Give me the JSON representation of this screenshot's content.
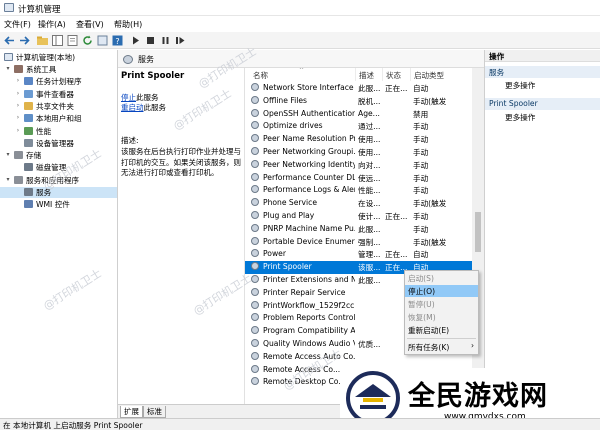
{
  "window": {
    "title": "计算机管理"
  },
  "menu": [
    "文件(F)",
    "操作(A)",
    "查看(V)",
    "帮助(H)"
  ],
  "tree": {
    "root": "计算机管理(本地)",
    "items": [
      {
        "label": "系统工具",
        "level": 1,
        "expander": "▾"
      },
      {
        "label": "任务计划程序",
        "level": 2,
        "expander": "›"
      },
      {
        "label": "事件查看器",
        "level": 2,
        "expander": "›"
      },
      {
        "label": "共享文件夹",
        "level": 2,
        "expander": "›"
      },
      {
        "label": "本地用户和组",
        "level": 2,
        "expander": "›"
      },
      {
        "label": "性能",
        "level": 2,
        "expander": "›"
      },
      {
        "label": "设备管理器",
        "level": 2,
        "expander": ""
      },
      {
        "label": "存储",
        "level": 1,
        "expander": "▾"
      },
      {
        "label": "磁盘管理",
        "level": 2,
        "expander": ""
      },
      {
        "label": "服务和应用程序",
        "level": 1,
        "expander": "▾"
      },
      {
        "label": "服务",
        "level": 2,
        "expander": "",
        "selected": true
      },
      {
        "label": "WMI 控件",
        "level": 2,
        "expander": ""
      }
    ]
  },
  "center": {
    "header": "服务",
    "service_name": "Print Spooler",
    "stop_link": "停止",
    "stop_suffix": "此服务",
    "restart_link": "重启动",
    "restart_suffix": "此服务",
    "desc_label": "描述:",
    "desc_text": "该服务在后台执行打印作业并处理与打印机的交互。如果关闭该服务，则无法进行打印或查看打印机。"
  },
  "columns": {
    "name": "名称",
    "desc": "描述",
    "status": "状态",
    "startup": "启动类型"
  },
  "services": [
    {
      "name": "Network Store Interface ...",
      "desc": "此服...",
      "status": "正在...",
      "startup": "自动"
    },
    {
      "name": "Offline Files",
      "desc": "脱机...",
      "status": "",
      "startup": "手动(触发"
    },
    {
      "name": "OpenSSH Authentication ...",
      "desc": "Age...",
      "status": "",
      "startup": "禁用"
    },
    {
      "name": "Optimize drives",
      "desc": "通过...",
      "status": "",
      "startup": "手动"
    },
    {
      "name": "Peer Name Resolution Pr...",
      "desc": "使用...",
      "status": "",
      "startup": "手动"
    },
    {
      "name": "Peer Networking Groupi...",
      "desc": "使用...",
      "status": "",
      "startup": "手动"
    },
    {
      "name": "Peer Networking Identity...",
      "desc": "向对...",
      "status": "",
      "startup": "手动"
    },
    {
      "name": "Performance Counter DL...",
      "desc": "使远...",
      "status": "",
      "startup": "手动"
    },
    {
      "name": "Performance Logs & Aler...",
      "desc": "性能...",
      "status": "",
      "startup": "手动"
    },
    {
      "name": "Phone Service",
      "desc": "在设...",
      "status": "",
      "startup": "手动(触发"
    },
    {
      "name": "Plug and Play",
      "desc": "使计...",
      "status": "正在...",
      "startup": "手动"
    },
    {
      "name": "PNRP Machine Name Pu...",
      "desc": "此服...",
      "status": "",
      "startup": "手动"
    },
    {
      "name": "Portable Device Enumera...",
      "desc": "强制...",
      "status": "",
      "startup": "手动(触发"
    },
    {
      "name": "Power",
      "desc": "管理...",
      "status": "正在...",
      "startup": "自动"
    },
    {
      "name": "Print Spooler",
      "desc": "该服...",
      "status": "正在...",
      "startup": "自动",
      "selected": true
    },
    {
      "name": "Printer Extensions and N...",
      "desc": "此服...",
      "status": "",
      "startup": ""
    },
    {
      "name": "Printer Repair Service",
      "desc": "",
      "status": "",
      "startup": ""
    },
    {
      "name": "PrintWorkflow_1529f2cc",
      "desc": "",
      "status": "",
      "startup": ""
    },
    {
      "name": "Problem Reports Control...",
      "desc": "",
      "status": "",
      "startup": ""
    },
    {
      "name": "Program Compatibility A...",
      "desc": "",
      "status": "",
      "startup": ""
    },
    {
      "name": "Quality Windows Audio V...",
      "desc": "优质...",
      "status": "",
      "startup": ""
    },
    {
      "name": "Remote Access Auto Co...",
      "desc": "",
      "status": "",
      "startup": ""
    },
    {
      "name": "Remote Access Co...",
      "desc": "",
      "status": "",
      "startup": ""
    },
    {
      "name": "Remote Desktop Co...",
      "desc": "",
      "status": "",
      "startup": ""
    }
  ],
  "context_menu": [
    {
      "label": "启动(S)",
      "disabled": true
    },
    {
      "label": "停止(O)",
      "disabled": false,
      "hover": true
    },
    {
      "label": "暂停(U)",
      "disabled": true
    },
    {
      "label": "恢复(M)",
      "disabled": true
    },
    {
      "label": "重新启动(E)",
      "disabled": false
    },
    {
      "label": "所有任务(K)",
      "disabled": false,
      "submenu": "›"
    }
  ],
  "tabs": [
    "扩展",
    "标准"
  ],
  "actions": {
    "title": "操作",
    "group1": "服务",
    "more1": "更多操作",
    "group2": "Print Spooler",
    "more2": "更多操作"
  },
  "status_text": "在 本地计算机 上启动服务 Print Spooler",
  "watermark": "@打印机卫士",
  "logo": {
    "text": "全民游戏网",
    "url": "www.qmydxs.com"
  }
}
